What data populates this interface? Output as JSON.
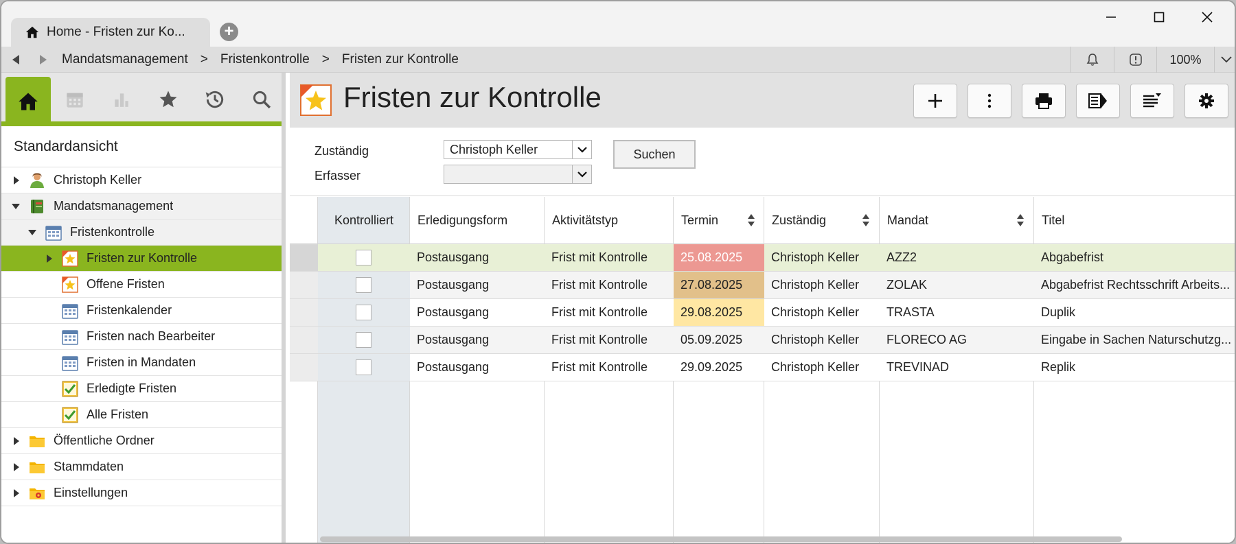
{
  "tab": {
    "title": "Home - Fristen zur Ko..."
  },
  "address": {
    "breadcrumbs": [
      "Mandatsmanagement",
      "Fristenkontrolle",
      "Fristen zur Kontrolle"
    ],
    "separator": ">",
    "zoom": "100%"
  },
  "sidebar": {
    "view_title": "Standardansicht",
    "tabs": [
      "home-icon",
      "calendar-icon",
      "bar-chart-icon",
      "star-icon",
      "history-icon",
      "search-icon"
    ],
    "tree": [
      {
        "label": "Christoph Keller",
        "icon": "user-icon"
      },
      {
        "label": "Mandatsmanagement",
        "icon": "book-icon"
      },
      {
        "label": "Fristenkontrolle",
        "icon": "calendar-icon"
      },
      {
        "label": "Fristen zur Kontrolle",
        "icon": "star-deadline-icon"
      },
      {
        "label": "Offene Fristen",
        "icon": "star-deadline-icon"
      },
      {
        "label": "Fristenkalender",
        "icon": "calendar-icon"
      },
      {
        "label": "Fristen nach Bearbeiter",
        "icon": "calendar-icon"
      },
      {
        "label": "Fristen in Mandaten",
        "icon": "calendar-icon"
      },
      {
        "label": "Erledigte Fristen",
        "icon": "check-deadline-icon"
      },
      {
        "label": "Alle Fristen",
        "icon": "check-deadline-icon"
      },
      {
        "label": "Öffentliche Ordner",
        "icon": "folder-icon"
      },
      {
        "label": "Stammdaten",
        "icon": "folder-icon"
      },
      {
        "label": "Einstellungen",
        "icon": "settings-folder-icon"
      }
    ]
  },
  "main": {
    "title": "Fristen zur Kontrolle",
    "filters": {
      "zustaendig_label": "Zuständig",
      "zustaendig_value": "Christoph Keller",
      "erfasser_label": "Erfasser",
      "erfasser_value": "",
      "search_label": "Suchen"
    },
    "table": {
      "columns": [
        "Kontrolliert",
        "Erledigungsform",
        "Aktivitätstyp",
        "Termin",
        "Zuständig",
        "Mandat",
        "Titel"
      ],
      "rows": [
        {
          "form": "Postausgang",
          "type": "Frist mit Kontrolle",
          "termin": "25.08.2025",
          "zustaendig": "Christoph Keller",
          "mandat": "AZZ2",
          "titel": "Abgabefrist"
        },
        {
          "form": "Postausgang",
          "type": "Frist mit Kontrolle",
          "termin": "27.08.2025",
          "zustaendig": "Christoph Keller",
          "mandat": "ZOLAK",
          "titel": "Abgabefrist Rechtsschrift Arbeits..."
        },
        {
          "form": "Postausgang",
          "type": "Frist mit Kontrolle",
          "termin": "29.08.2025",
          "zustaendig": "Christoph Keller",
          "mandat": "TRASTA",
          "titel": "Duplik"
        },
        {
          "form": "Postausgang",
          "type": "Frist mit Kontrolle",
          "termin": "05.09.2025",
          "zustaendig": "Christoph Keller",
          "mandat": "FLORECO AG",
          "titel": "Eingabe in Sachen Naturschutzg..."
        },
        {
          "form": "Postausgang",
          "type": "Frist mit Kontrolle",
          "termin": "29.09.2025",
          "zustaendig": "Christoph Keller",
          "mandat": "TREVINAD",
          "titel": "Replik"
        }
      ]
    }
  },
  "colors": {
    "accent": "#8ab51f",
    "selected_row": "#e8f0d6",
    "termin_overdue": "#ec9892",
    "termin_soon": "#e2c08a",
    "termin_upcoming": "#ffe7a3"
  }
}
